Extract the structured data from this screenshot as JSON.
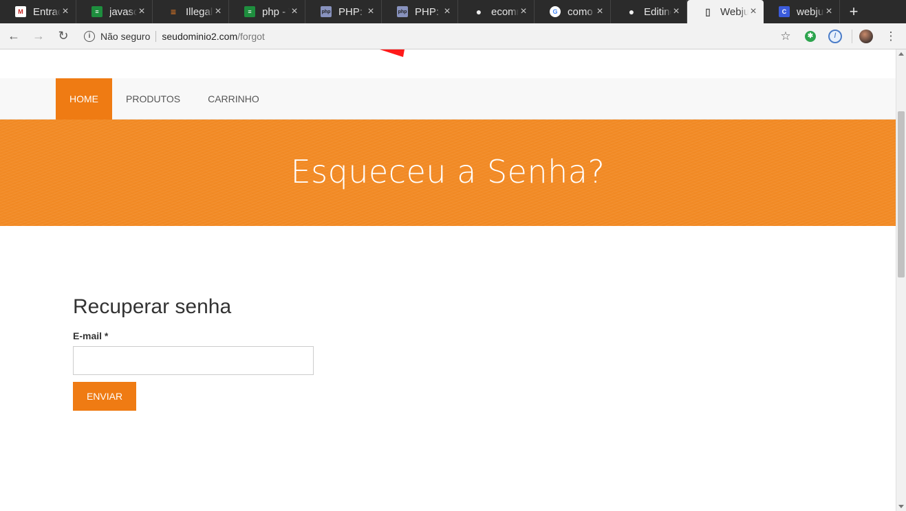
{
  "browser": {
    "tabs": [
      {
        "label": "Entrada",
        "icon": "gmail-icon",
        "icon_color": "#c5221f",
        "icon_text": "M"
      },
      {
        "label": "javascript",
        "icon": "sheets-icon",
        "icon_color": "#1e8e3e",
        "icon_text": "≡"
      },
      {
        "label": "Illegal",
        "icon": "stackoverflow-icon",
        "icon_color": "#f48024",
        "icon_text": "≡"
      },
      {
        "label": "php - W",
        "icon": "sheets-icon",
        "icon_color": "#1e8e3e",
        "icon_text": "≡"
      },
      {
        "label": "PHP: ar",
        "icon": "php-icon",
        "icon_color": "#8892be",
        "icon_text": "php"
      },
      {
        "label": "PHP: fo",
        "icon": "php-icon",
        "icon_color": "#8892be",
        "icon_text": "php"
      },
      {
        "label": "ecomm",
        "icon": "github-icon",
        "icon_color": "#eeeeee",
        "icon_text": "●"
      },
      {
        "label": "como t",
        "icon": "google-icon",
        "icon_color": "#ffffff",
        "icon_text": "G"
      },
      {
        "label": "Editing",
        "icon": "github-icon",
        "icon_color": "#eeeeee",
        "icon_text": "●"
      },
      {
        "label": "Webju",
        "icon": "page-icon",
        "icon_color": "#ffffff",
        "icon_text": "▯",
        "active": true
      },
      {
        "label": "webjur",
        "icon": "site-icon",
        "icon_color": "#3b5bdb",
        "icon_text": "C"
      }
    ],
    "new_tab": "+",
    "address": {
      "security": "Não seguro",
      "host": "seudominio2.com",
      "path": "/forgot"
    }
  },
  "nav": {
    "items": [
      {
        "label": "HOME",
        "active": true
      },
      {
        "label": "PRODUTOS"
      },
      {
        "label": "CARRINHO"
      }
    ]
  },
  "hero": {
    "title": "Esqueceu a Senha?"
  },
  "form": {
    "heading": "Recuperar senha",
    "email_label": "E-mail *",
    "email_value": "",
    "submit_label": "ENVIAR"
  },
  "colors": {
    "accent": "#ef7b13",
    "hero_bg": "#f28b26"
  }
}
